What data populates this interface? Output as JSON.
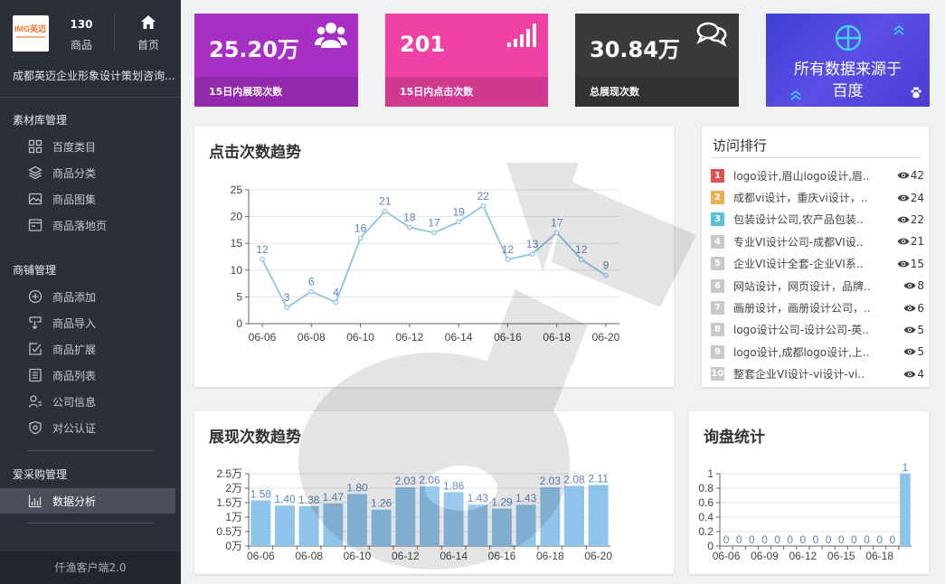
{
  "sidebar": {
    "logo_text": "IMG英迈",
    "product_count": "130",
    "product_label": "商品",
    "home_label": "首页",
    "company_name": "成都英迈企业形象设计策划咨询...",
    "groups": [
      {
        "title": "素材库管理",
        "items": [
          {
            "label": "百度类目",
            "icon": "grid-icon"
          },
          {
            "label": "商品分类",
            "icon": "layers-icon"
          },
          {
            "label": "商品图集",
            "icon": "image-icon"
          },
          {
            "label": "商品落地页",
            "icon": "page-icon"
          }
        ]
      },
      {
        "title": "商铺管理",
        "items": [
          {
            "label": "商品添加",
            "icon": "plus-circle-icon"
          },
          {
            "label": "商品导入",
            "icon": "import-icon"
          },
          {
            "label": "商品扩展",
            "icon": "expand-icon"
          },
          {
            "label": "商品列表",
            "icon": "list-icon"
          },
          {
            "label": "公司信息",
            "icon": "user-info-icon"
          },
          {
            "label": "对公认证",
            "icon": "shield-icon"
          }
        ]
      },
      {
        "title": "爱采购管理",
        "items": [
          {
            "label": "数据分析",
            "icon": "bar-chart-icon",
            "active": true
          }
        ]
      }
    ],
    "footer": "仟渔客户端2.0"
  },
  "cards": [
    {
      "value": "25.20万",
      "label": "15日内展现次数",
      "color": "#a82fc4",
      "icon": "users-icon"
    },
    {
      "value": "201",
      "label": "15日内点击次数",
      "color": "#f042a4",
      "icon": "signal-icon"
    },
    {
      "value": "30.84万",
      "label": "总展现次数",
      "color": "#3a3a3a",
      "icon": "chat-icon"
    }
  ],
  "baidu_card": {
    "text_line1": "所有数据来源于",
    "text_line2": "百度"
  },
  "click_panel": {
    "title": "点击次数趋势"
  },
  "rank_panel": {
    "title": "访问排行",
    "items": [
      {
        "rank": "1",
        "text": "logo设计,眉山logo设计,眉..",
        "count": "42",
        "color": "#d9534f"
      },
      {
        "rank": "2",
        "text": "成都vi设计，重庆vi设计，..",
        "count": "24",
        "color": "#f0ad4e"
      },
      {
        "rank": "3",
        "text": "包装设计公司,农产品包装..",
        "count": "22",
        "color": "#5bc0de"
      },
      {
        "rank": "4",
        "text": "专业VI设计公司-成都VI设..",
        "count": "21",
        "color": "#c8c8c8"
      },
      {
        "rank": "5",
        "text": "企业VI设计全套-企业VI系..",
        "count": "15",
        "color": "#c8c8c8"
      },
      {
        "rank": "6",
        "text": "网站设计，网页设计，品牌..",
        "count": "8",
        "color": "#c8c8c8"
      },
      {
        "rank": "7",
        "text": "画册设计，画册设计公司，..",
        "count": "6",
        "color": "#c8c8c8"
      },
      {
        "rank": "8",
        "text": "logo设计公司-设计公司-英..",
        "count": "5",
        "color": "#c8c8c8"
      },
      {
        "rank": "9",
        "text": "logo设计,成都logo设计,上..",
        "count": "5",
        "color": "#c8c8c8"
      },
      {
        "rank": "10",
        "text": "整套企业VI设计-vi设计-vi..",
        "count": "4",
        "color": "#c8c8c8"
      }
    ]
  },
  "show_panel": {
    "title": "展现次数趋势"
  },
  "inquiry_panel": {
    "title": "询盘统计"
  },
  "chart_data": [
    {
      "type": "line",
      "x": [
        "06-06",
        "06-07",
        "06-08",
        "06-09",
        "06-10",
        "06-11",
        "06-12",
        "06-13",
        "06-14",
        "06-15",
        "06-16",
        "06-17",
        "06-18",
        "06-19",
        "06-20"
      ],
      "xticks": [
        "06-06",
        "06-08",
        "06-10",
        "06-12",
        "06-14",
        "06-16",
        "06-18",
        "06-20"
      ],
      "values": [
        12,
        3,
        6,
        4,
        16,
        21,
        18,
        17,
        19,
        22,
        12,
        13,
        17,
        12,
        9
      ],
      "yticks": [
        "0",
        "5",
        "10",
        "15",
        "20",
        "25"
      ],
      "ylim": [
        0,
        25
      ],
      "grid": true,
      "color": "#8cc4e6",
      "label_color": "#5a84b8"
    },
    {
      "type": "bar",
      "x": [
        "06-06",
        "06-07",
        "06-08",
        "06-09",
        "06-10",
        "06-11",
        "06-12",
        "06-13",
        "06-14",
        "06-15",
        "06-16",
        "06-17",
        "06-18",
        "06-19",
        "06-20"
      ],
      "xticks": [
        "06-06",
        "06-08",
        "06-10",
        "06-12",
        "06-14",
        "06-16",
        "06-18",
        "06-20"
      ],
      "values": [
        1.58,
        1.4,
        1.38,
        1.47,
        1.8,
        1.26,
        2.03,
        2.06,
        1.86,
        1.43,
        1.29,
        1.43,
        2.03,
        2.08,
        2.11
      ],
      "labels": [
        "1.58",
        "1.40",
        "1.38",
        "1.47",
        "1.80",
        "1.26",
        "2.03",
        "2.06",
        "1.86",
        "1.43",
        "1.29",
        "1.43",
        "2.03",
        "2.08",
        "2.11"
      ],
      "yticks": [
        "0万",
        "0.5万",
        "1万",
        "1.5万",
        "2万",
        "2.5万"
      ],
      "ylim": [
        0,
        2.5
      ],
      "grid": true,
      "color": "#8ec3ea",
      "label_color": "#5a84b8"
    },
    {
      "type": "bar",
      "x": [
        "06-06",
        "06-07",
        "06-08",
        "06-09",
        "06-10",
        "06-11",
        "06-12",
        "06-13",
        "06-14",
        "06-15",
        "06-16",
        "06-17",
        "06-18",
        "06-19",
        "06-20"
      ],
      "xticks": [
        "06-06",
        "06-09",
        "06-12",
        "06-15",
        "06-18"
      ],
      "values": [
        0,
        0,
        0,
        0,
        0,
        0,
        0,
        0,
        0,
        0,
        0,
        0,
        0,
        0,
        1
      ],
      "labels": [
        "0",
        "0",
        "0",
        "0",
        "0",
        "0",
        "0",
        "0",
        "0",
        "0",
        "0",
        "0",
        "0",
        "0",
        "1"
      ],
      "yticks": [
        "0",
        "0.2",
        "0.4",
        "0.6",
        "0.8",
        "1"
      ],
      "ylim": [
        0,
        1
      ],
      "grid": true,
      "color": "#8ec3ea",
      "label_color": "#5a84b8"
    }
  ]
}
